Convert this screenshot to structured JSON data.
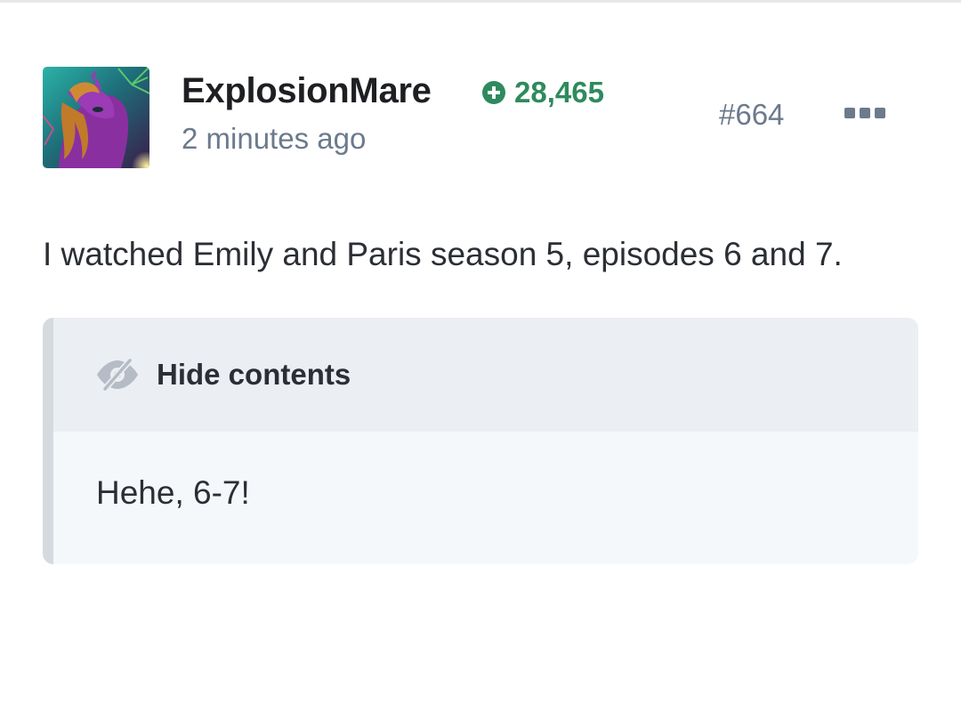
{
  "post": {
    "author": {
      "username": "ExplosionMare",
      "avatar_icon": "pony-avatar",
      "reputation": "28,465",
      "reputation_icon": "plus-circle-icon"
    },
    "timestamp": "2 minutes ago",
    "post_number": "#664",
    "menu_icon": "more-dots-icon",
    "body": "I watched Emily and Paris season 5, episodes 6 and 7.",
    "spoiler": {
      "toggle_label": "Hide contents",
      "toggle_icon": "eye-slash-icon",
      "content": "Hehe, 6-7!"
    }
  },
  "colors": {
    "reputation": "#2f8a5e",
    "muted_text": "#6c7a8c",
    "spoiler_header_bg": "#ebeff3",
    "spoiler_body_bg": "#f5f8fb",
    "spoiler_bar": "#d5dadf"
  }
}
